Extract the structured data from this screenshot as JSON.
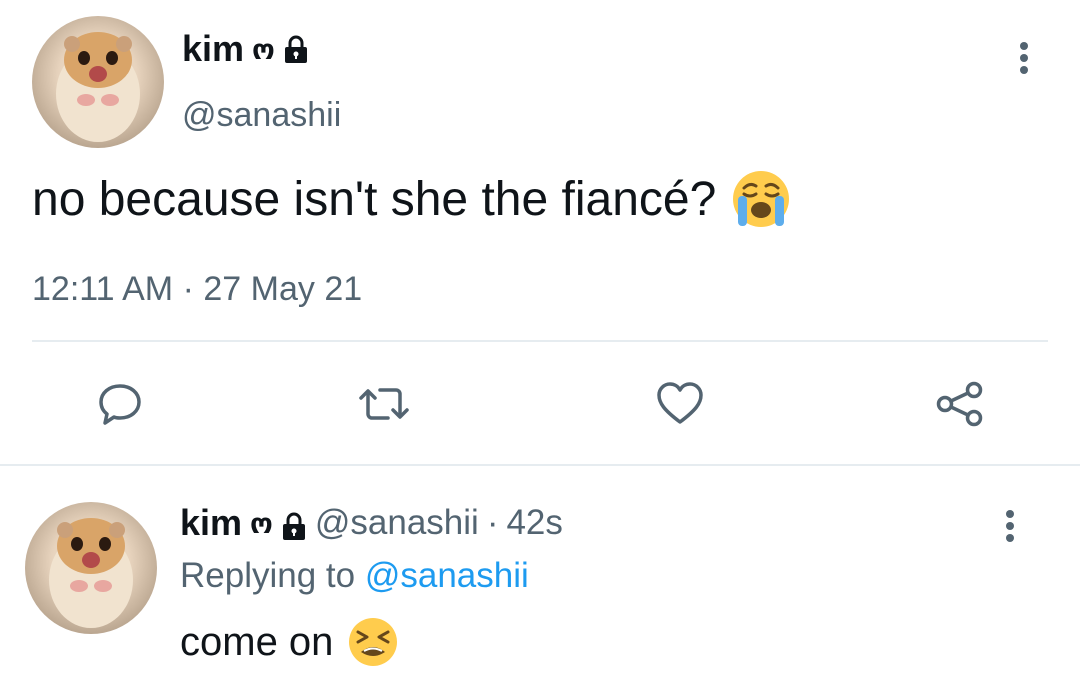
{
  "tweet": {
    "author": {
      "display_name": "kim",
      "name_symbol": "ო",
      "handle": "@sanashii",
      "avatar_icon": "hamster-avatar",
      "locked_icon": "lock-icon"
    },
    "text": "no because isn't she the fiancé?",
    "emoji": "loudly-crying-face-emoji",
    "time": "12:11 AM",
    "separator": "·",
    "date": "27 May 21",
    "actions": [
      {
        "name": "reply",
        "icon": "comment-icon"
      },
      {
        "name": "retweet",
        "icon": "retweet-icon"
      },
      {
        "name": "like",
        "icon": "heart-icon"
      },
      {
        "name": "share",
        "icon": "share-icon"
      }
    ],
    "more_icon": "more-vertical-icon"
  },
  "reply": {
    "author": {
      "display_name": "kim",
      "name_symbol": "ო",
      "handle": "@sanashii",
      "avatar_icon": "hamster-avatar"
    },
    "separator": "·",
    "age": "42s",
    "replying_to_label": "Replying to",
    "replying_to_handle": "@sanashii",
    "text": "come on",
    "emoji": "tired-face-emoji",
    "more_icon": "more-vertical-icon"
  },
  "colors": {
    "text_primary": "#0f1419",
    "text_secondary": "#536471",
    "link": "#1d9bf0",
    "divider": "#e6ecf0"
  }
}
